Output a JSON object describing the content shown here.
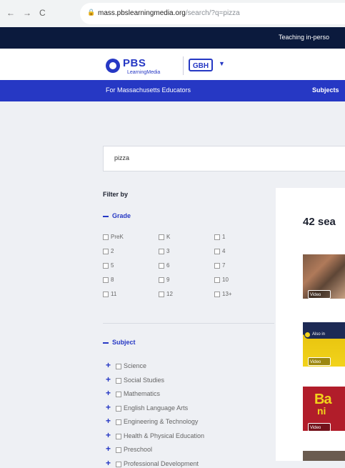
{
  "browser": {
    "back_icon": "←",
    "forward_icon": "→",
    "reload_icon": "C",
    "url_host": "mass.pbslearningmedia.org",
    "url_path": "/search/?q=pizza"
  },
  "banner": {
    "text": "Teaching in-perso"
  },
  "header": {
    "logo_text": "PBS",
    "logo_subtext": "LearningMedia",
    "partner_logo": "GBH"
  },
  "nav": {
    "left_label": "For Massachusetts Educators",
    "right_label": "Subjects"
  },
  "search": {
    "value": "pizza"
  },
  "filters": {
    "title": "Filter by",
    "grade_heading": "Grade",
    "grades": [
      "PreK",
      "K",
      "1",
      "2",
      "3",
      "4",
      "5",
      "6",
      "7",
      "8",
      "9",
      "10",
      "11",
      "12",
      "13+"
    ],
    "subject_heading": "Subject",
    "subjects": [
      "Science",
      "Social Studies",
      "Mathematics",
      "English Language Arts",
      "Engineering & Technology",
      "Health & Physical Education",
      "Preschool",
      "Professional Development"
    ]
  },
  "results": {
    "heading": "42 sea",
    "video_badge": "Video",
    "also_badge": "Also in",
    "thumb3_text_1": "Ba",
    "thumb3_text_2": "ni"
  }
}
